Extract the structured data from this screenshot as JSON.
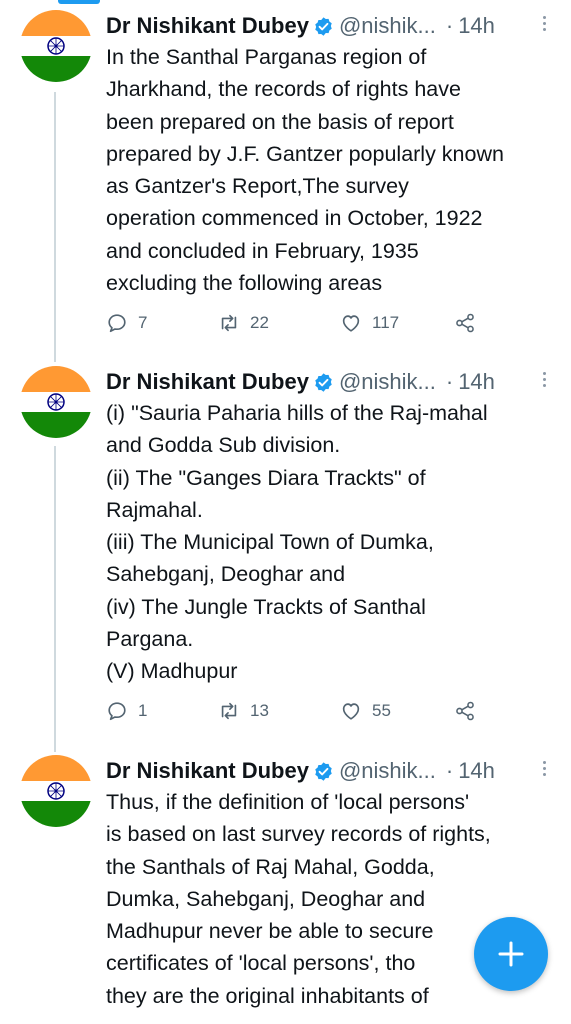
{
  "tweets": [
    {
      "author_name": "Dr Nishikant Dubey",
      "handle": "@nishik...",
      "separator": "·",
      "time": "14h",
      "text_lines": [
        "In the Santhal Parganas region of",
        "Jharkhand, the records of rights have",
        "been prepared on the basis of report",
        "prepared by J.F. Gantzer popularly known",
        "as Gantzer's Report,The survey",
        "operation commenced in October, 1922",
        "and concluded in February, 1935",
        "excluding the following areas"
      ],
      "replies": "7",
      "retweets": "22",
      "likes": "117"
    },
    {
      "author_name": "Dr Nishikant Dubey",
      "handle": "@nishik...",
      "separator": "·",
      "time": "14h",
      "text_lines": [
        "(i) \"Sauria Paharia hills of the Raj-mahal",
        "and Godda Sub division.",
        "(ii) The \"Ganges Diara Trackts\" of",
        "Rajmahal.",
        "(iii) The Municipal Town of Dumka,",
        "Sahebganj, Deoghar and",
        "(iv) The Jungle Trackts of Santhal",
        "Pargana.",
        "(V) Madhupur"
      ],
      "replies": "1",
      "retweets": "13",
      "likes": "55"
    },
    {
      "author_name": "Dr Nishikant Dubey",
      "handle": "@nishik...",
      "separator": "·",
      "time": "14h",
      "text_lines": [
        "Thus, if the definition of 'local persons'",
        "is based on last survey records of rights,",
        "the Santhals of Raj Mahal, Godda,",
        "Dumka, Sahebganj, Deoghar and",
        "Madhupur never be able to secure",
        "certificates of 'local persons', tho",
        "they are the original inhabitants of"
      ]
    }
  ],
  "icons": {
    "verified": "verified-badge-icon",
    "reply": "reply-icon",
    "retweet": "retweet-icon",
    "like": "heart-icon",
    "share": "share-icon",
    "more": "more-vertical-icon",
    "compose": "plus-icon"
  },
  "colors": {
    "accent": "#1d9bf0",
    "secondary_text": "#536471",
    "thread_line": "#cfd9de",
    "flag_saffron": "#ff9933",
    "flag_green": "#138808",
    "chakra_navy": "#000080"
  }
}
